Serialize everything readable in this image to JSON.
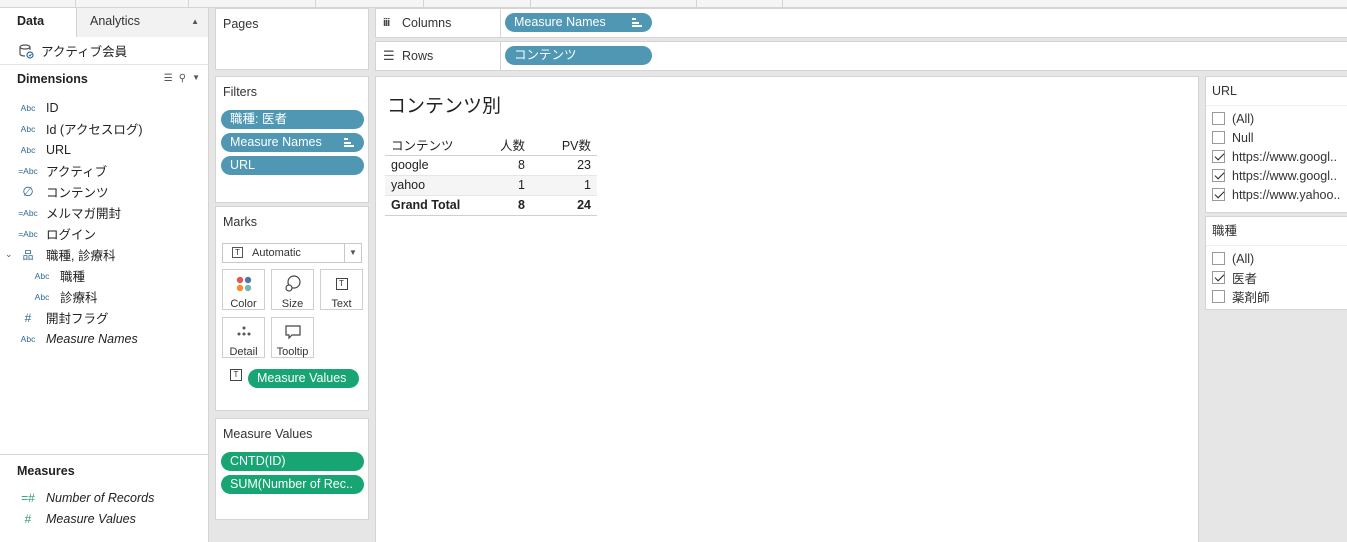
{
  "left_pane": {
    "tabs": [
      {
        "label": "Data"
      },
      {
        "label": "Analytics"
      }
    ],
    "datasource": "アクティブ会員",
    "dimensions_header": "Dimensions",
    "dimensions": [
      {
        "type": "Abc",
        "label": "ID"
      },
      {
        "type": "Abc",
        "label": "Id (アクセスログ)"
      },
      {
        "type": "Abc",
        "label": "URL"
      },
      {
        "type": "=Abc",
        "label": "アクティブ"
      },
      {
        "type": "clip",
        "label": "コンテンツ"
      },
      {
        "type": "=Abc",
        "label": "メルマガ開封"
      },
      {
        "type": "=Abc",
        "label": "ログイン"
      },
      {
        "type": "hier",
        "label": "職種, 診療科"
      },
      {
        "type": "Abc",
        "label": "職種"
      },
      {
        "type": "Abc",
        "label": "診療科"
      },
      {
        "type": "#",
        "label": "開封フラグ"
      },
      {
        "type": "Abc",
        "label": "Measure Names"
      }
    ],
    "measures_header": "Measures",
    "measures": [
      {
        "type": "=#",
        "label": "Number of Records"
      },
      {
        "type": "#",
        "label": "Measure Values"
      }
    ]
  },
  "pages": {
    "title": "Pages"
  },
  "filters": {
    "title": "Filters",
    "pills": [
      "職種: 医者",
      "Measure Names",
      "URL"
    ]
  },
  "marks": {
    "title": "Marks",
    "mark_type": "Automatic",
    "buttons": [
      "Color",
      "Size",
      "Text",
      "Detail",
      "Tooltip"
    ],
    "text_pill": "Measure Values"
  },
  "measure_values_card": {
    "title": "Measure Values",
    "pills": [
      "CNTD(ID)",
      "SUM(Number of Rec.."
    ]
  },
  "shelves": {
    "columns_label": "Columns",
    "columns_pill": "Measure Names",
    "rows_label": "Rows",
    "rows_pill": "コンテンツ"
  },
  "view": {
    "title": "コンテンツ別",
    "headers": [
      "コンテンツ",
      "人数",
      "PV数"
    ],
    "rows": [
      {
        "label": "google",
        "people": "8",
        "pv": "23"
      },
      {
        "label": "yahoo",
        "people": "1",
        "pv": "1"
      }
    ],
    "total": {
      "label": "Grand Total",
      "people": "8",
      "pv": "24"
    }
  },
  "url_filter": {
    "title": "URL",
    "options": [
      {
        "label": "(All)",
        "checked": false
      },
      {
        "label": "Null",
        "checked": false
      },
      {
        "label": "https://www.googl..",
        "checked": true
      },
      {
        "label": "https://www.googl..",
        "checked": true
      },
      {
        "label": "https://www.yahoo..",
        "checked": true
      }
    ]
  },
  "job_filter": {
    "title": "職種",
    "options": [
      {
        "label": "(All)",
        "checked": false
      },
      {
        "label": "医者",
        "checked": true
      },
      {
        "label": "薬剤師",
        "checked": false
      }
    ]
  },
  "colors": {
    "dimension_pill": "#4f97b3",
    "measure_pill": "#17a673"
  }
}
